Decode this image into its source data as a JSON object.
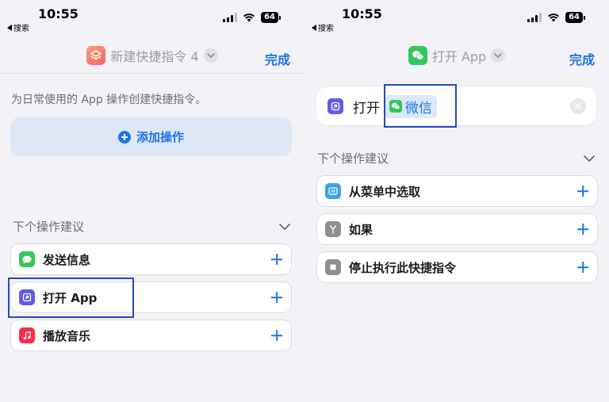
{
  "status": {
    "time": "10:55",
    "back_label": "搜索",
    "battery": "64"
  },
  "left": {
    "nav": {
      "title": "新建快捷指令 4",
      "done": "完成"
    },
    "hint": "为日常使用的 App 操作创建快捷指令。",
    "add_action": "添加操作",
    "suggestions": {
      "title": "下个操作建议",
      "items": [
        {
          "label": "发送信息",
          "icon": "messages-icon"
        },
        {
          "label": "打开 App",
          "icon": "open-app-icon"
        },
        {
          "label": "播放音乐",
          "icon": "music-icon"
        }
      ]
    }
  },
  "right": {
    "nav": {
      "title": "打开 App",
      "done": "完成"
    },
    "action": {
      "verb": "打开",
      "app": "微信"
    },
    "suggestions": {
      "title": "下个操作建议",
      "items": [
        {
          "label": "从菜单中选取",
          "icon": "menu-icon"
        },
        {
          "label": "如果",
          "icon": "if-icon"
        },
        {
          "label": "停止执行此快捷指令",
          "icon": "stop-icon"
        }
      ]
    }
  },
  "colors": {
    "accent": "#1f74e8",
    "highlight": "#2747c9",
    "wechat": "#30c85a"
  }
}
